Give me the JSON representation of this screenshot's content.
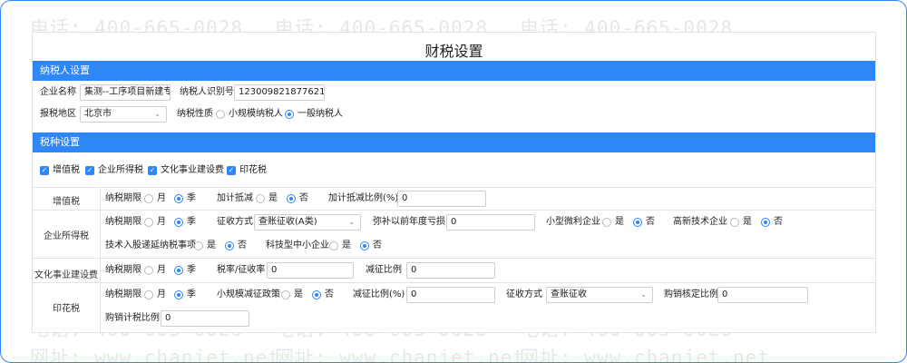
{
  "watermark": {
    "phone": "电话: 400-665-0028",
    "site": "网址: www.chanjet.net"
  },
  "page_title": "财税设置",
  "taxpayer": {
    "header": "纳税人设置",
    "company_label": "企业名称",
    "company_value": "集测--工序项目新建专(",
    "taxid_label": "纳税人识别号",
    "taxid_value": "123009821877621",
    "region_label": "报税地区",
    "region_value": "北京市",
    "nature_label": "纳税性质",
    "nature_options": [
      "小规模纳税人",
      "一般纳税人"
    ]
  },
  "taxtype": {
    "header": "税种设置",
    "checks": [
      "增值税",
      "企业所得税",
      "文化事业建设费",
      "印花税"
    ]
  },
  "common": {
    "period_label": "纳税期限",
    "month": "月",
    "quarter": "季",
    "yes": "是",
    "no": "否"
  },
  "vat": {
    "name": "增值税",
    "deduct_label": "加计抵减",
    "ratio_label": "加计抵减比例(%)",
    "ratio_value": "0"
  },
  "income": {
    "name": "企业所得税",
    "method_label": "征收方式",
    "method_value": "查账征收(A类)",
    "loss_label": "弥补以前年度亏损",
    "loss_value": "0",
    "small_label": "小型微利企业",
    "hightech_label": "高新技术企业",
    "deferral_label": "技术入股递延纳税事项",
    "sme_label": "科技型中小企业"
  },
  "culture": {
    "name": "文化事业建设费",
    "rate_label": "税率/征收率",
    "rate_value": "0",
    "reduce_label": "减征比例",
    "reduce_value": "0"
  },
  "stamp": {
    "name": "印花税",
    "policy_label": "小规模减征政策",
    "reduce_label": "减征比例(%)",
    "reduce_value": "0",
    "method_label": "征收方式",
    "method_value": "查账征收",
    "purchase_label": "购销核定比例",
    "purchase_value": "0",
    "sale_label": "购销计税比例",
    "sale_value": "0"
  }
}
